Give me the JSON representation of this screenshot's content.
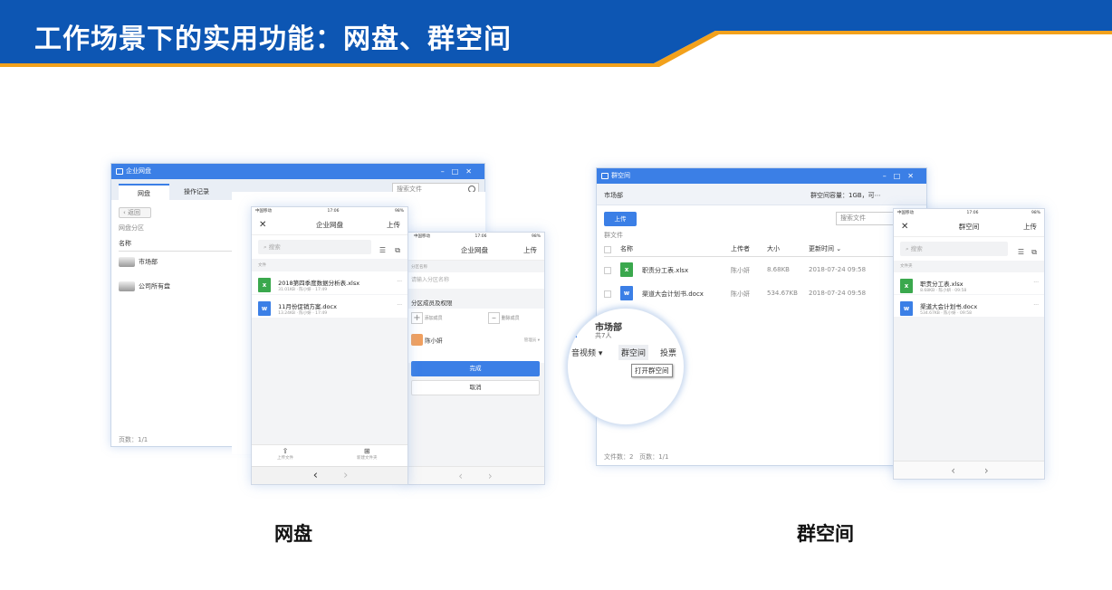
{
  "banner": {
    "title": "工作场景下的实用功能：网盘、群空间"
  },
  "captions": {
    "left": "网盘",
    "right": "群空间"
  },
  "netdisk_desktop": {
    "window_title": "企业网盘",
    "tabs": [
      "网盘",
      "操作记录"
    ],
    "search_placeholder": "搜索文件",
    "back": "返回",
    "section": "网盘分区",
    "column_name": "名称",
    "folders": [
      "市场部",
      "公司所有盘"
    ],
    "footer": "页数：1/1"
  },
  "netdisk_phone1": {
    "status_left": "中国移动",
    "status_time": "17:06",
    "status_right": "98%",
    "title": "企业网盘",
    "close": "✕",
    "action": "上传",
    "search": "搜索",
    "section": "文件",
    "files": [
      {
        "name": "2018第四季度数据分析表.xlsx",
        "meta": "31.01KB · 陈小妍 · 17:49",
        "type": "xls"
      },
      {
        "name": "11月份促销方案.docx",
        "meta": "13.24KB · 陈小妍 · 17:49",
        "type": "doc"
      }
    ],
    "bottom": [
      "上传文件",
      "新建文件夹"
    ],
    "nav_back": "‹",
    "nav_fwd": "›"
  },
  "netdisk_phone2": {
    "status_left": "中国移动",
    "status_time": "17:06",
    "status_right": "98%",
    "title": "企业网盘",
    "action": "上传",
    "field_label": "分区名称",
    "field_placeholder": "请输入分区名称",
    "members_title": "分区成员及权限",
    "add_member": "添加成员",
    "remove_member": "删除成员",
    "member_name": "陈小妍",
    "member_role": "管理员 ▾",
    "done": "完成",
    "cancel": "取消",
    "nav_back": "‹",
    "nav_fwd": "›"
  },
  "group_desktop": {
    "window_title": "群空间",
    "group_name": "市场部",
    "capacity": "群空间容量：1GB，可⋯",
    "upload": "上传",
    "search_placeholder": "搜索文件",
    "section": "群文件",
    "columns": [
      "名称",
      "上传者",
      "大小",
      "更新时间 ⌄"
    ],
    "rows": [
      {
        "name": "职责分工表.xlsx",
        "uploader": "陈小妍",
        "size": "8.68KB",
        "time": "2018-07-24 09:58",
        "type": "xls"
      },
      {
        "name": "渠道大会计划书.docx",
        "uploader": "陈小妍",
        "size": "534.67KB",
        "time": "2018-07-24 09:58",
        "type": "doc"
      }
    ],
    "footer": "文件数：2   页数：1/1"
  },
  "magnifier": {
    "group": "市场部",
    "count": "共7人",
    "menu": [
      "音视频 ▾",
      "群空间",
      "投票"
    ],
    "tooltip": "打开群空间"
  },
  "group_phone": {
    "status_left": "中国移动",
    "status_time": "17:06",
    "status_right": "98%",
    "title": "群空间",
    "close": "✕",
    "action": "上传",
    "search": "搜索",
    "section": "文件夹",
    "files": [
      {
        "name": "职责分工表.xlsx",
        "meta": "8.68KB · 陈小妍 · 09:58",
        "type": "xls"
      },
      {
        "name": "渠道大会计划书.docx",
        "meta": "534.67KB · 陈小妍 · 09:58",
        "type": "doc"
      }
    ],
    "nav_back": "‹",
    "nav_fwd": "›"
  }
}
